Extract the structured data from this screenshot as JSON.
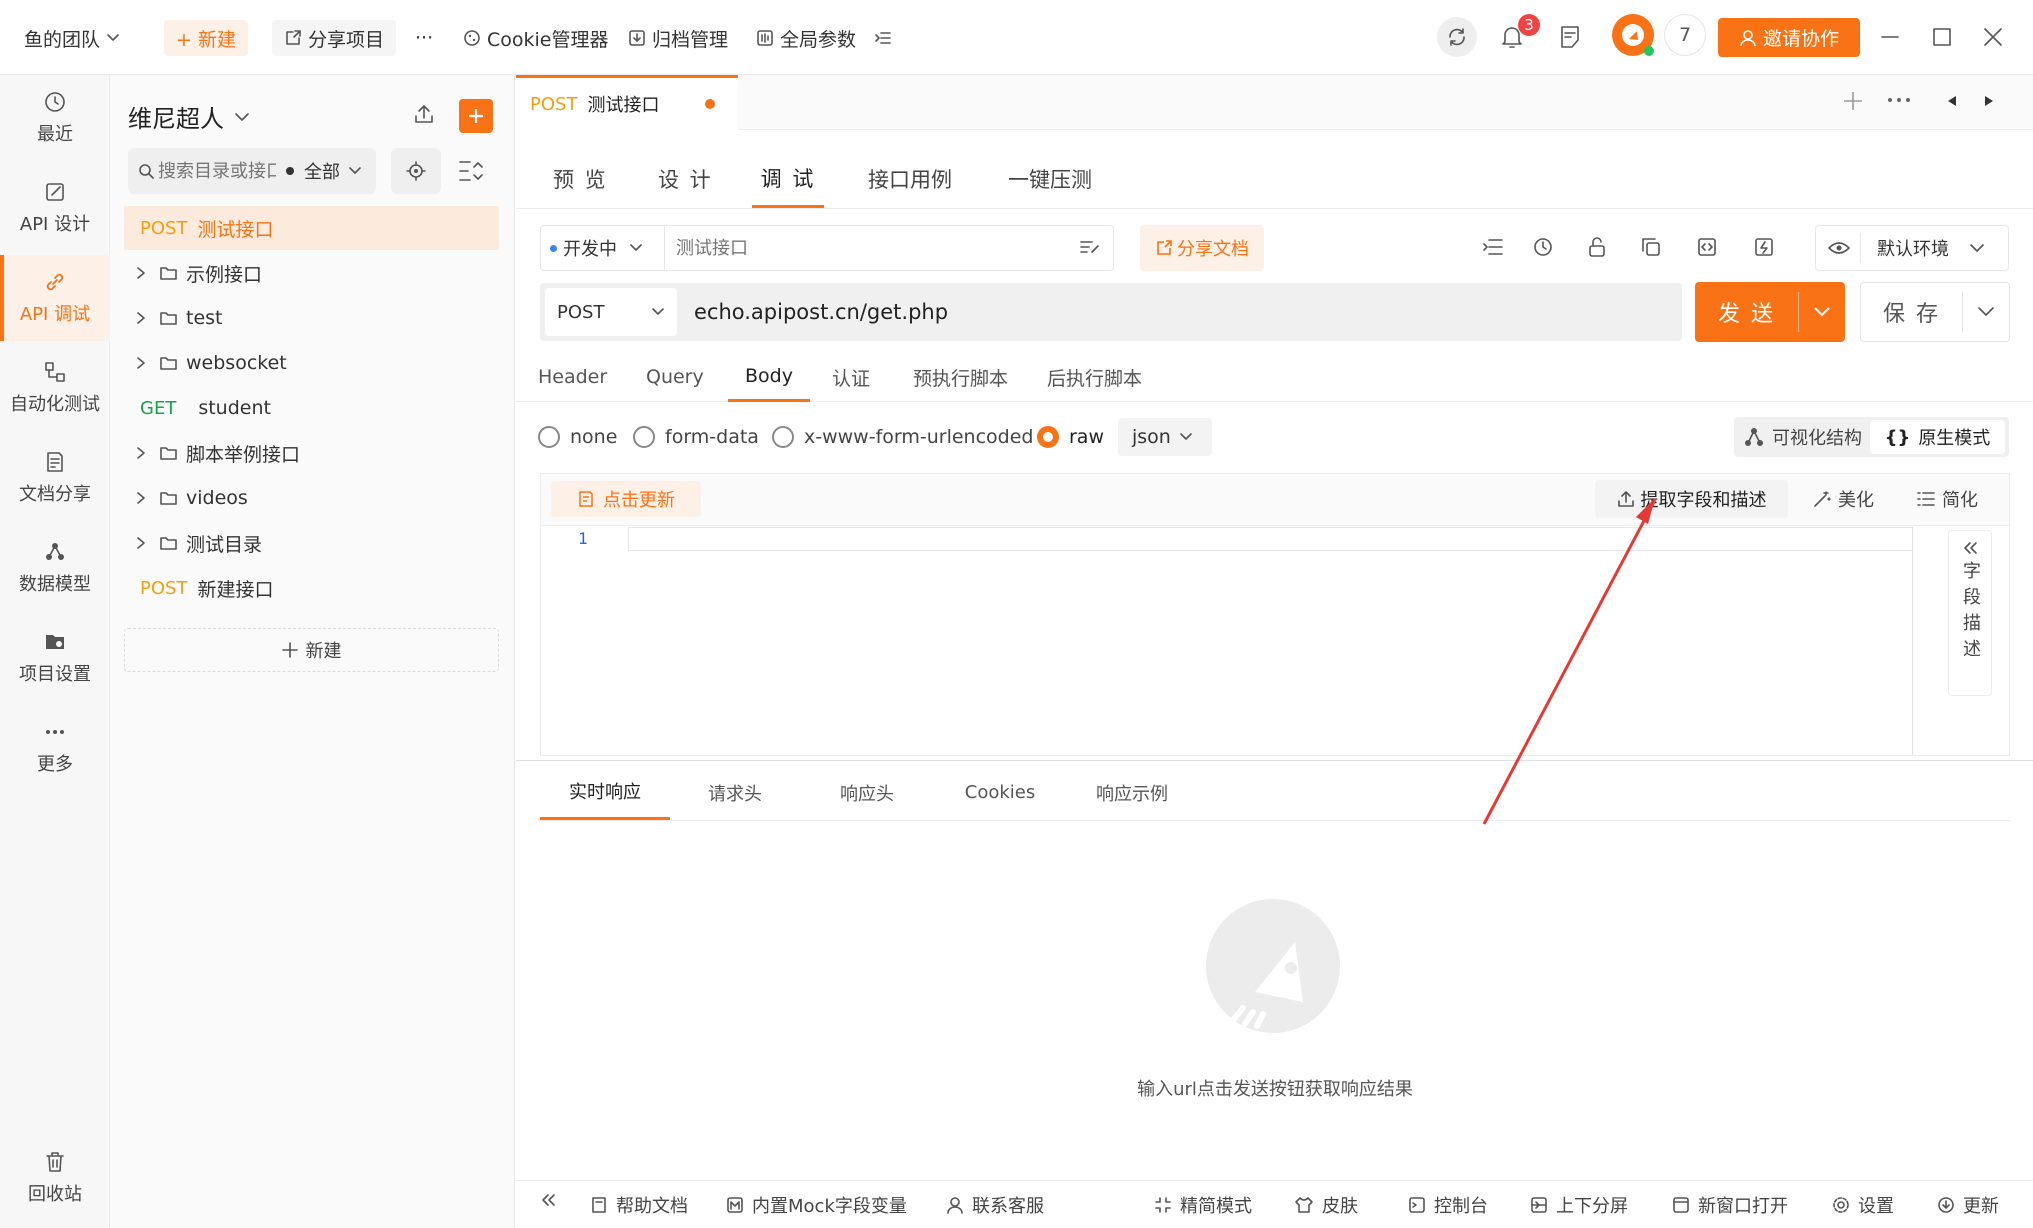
{
  "topbar": {
    "team": "鱼的团队",
    "new_btn": "+ 新建",
    "share_project": "分享项目",
    "more": "···",
    "cookie_mgr": "Cookie管理器",
    "archive": "归档管理",
    "global_params": "全局参数",
    "notification_count": "3",
    "user_count": "7",
    "invite": "邀请协作"
  },
  "rail": [
    {
      "label": "最近",
      "icon": "clock-icon"
    },
    {
      "label": "API 设计",
      "icon": "edit-icon"
    },
    {
      "label": "API 调试",
      "icon": "link-icon"
    },
    {
      "label": "自动化测试",
      "icon": "flow-icon"
    },
    {
      "label": "文档分享",
      "icon": "doc-icon"
    },
    {
      "label": "数据模型",
      "icon": "model-icon"
    },
    {
      "label": "项目设置",
      "icon": "folder-gear-icon"
    },
    {
      "label": "更多",
      "icon": "more-icon"
    },
    {
      "label": "回收站",
      "icon": "trash-icon"
    }
  ],
  "sidebar": {
    "project": "维尼超人",
    "search_placeholder": "搜索目录或接口",
    "filter": "全部",
    "new_label": "新建",
    "items": [
      {
        "method": "POST",
        "label": "测试接口"
      },
      {
        "label": "示例接口"
      },
      {
        "label": "test"
      },
      {
        "label": "websocket"
      },
      {
        "method": "GET",
        "label": "student"
      },
      {
        "label": "脚本举例接口"
      },
      {
        "label": "videos"
      },
      {
        "label": "测试目录"
      },
      {
        "method": "POST",
        "label": "新建接口"
      }
    ]
  },
  "tab": {
    "method": "POST",
    "label": "测试接口"
  },
  "subnav": [
    "预 览",
    "设 计",
    "调 试",
    "接口用例",
    "一键压测"
  ],
  "toolbar": {
    "status": "开发中",
    "name_placeholder": "测试接口",
    "share_doc": "分享文档",
    "env": "默认环境"
  },
  "request": {
    "method": "POST",
    "url": "echo.apipost.cn/get.php",
    "send": "发 送",
    "save": "保 存"
  },
  "req_tabs": [
    "Header",
    "Query",
    "Body",
    "认证",
    "预执行脚本",
    "后执行脚本"
  ],
  "body": {
    "types": [
      "none",
      "form-data",
      "x-www-form-urlencoded",
      "raw"
    ],
    "selected": "raw",
    "format": "json",
    "mode_visual": "可视化结构",
    "mode_raw": "原生模式",
    "update": "点击更新",
    "extract": "提取字段和描述",
    "beautify": "美化",
    "simplify": "简化",
    "line1": "1",
    "field_desc": "字段描述"
  },
  "response": {
    "tabs": [
      "实时响应",
      "请求头",
      "响应头",
      "Cookies",
      "响应示例"
    ],
    "empty": "输入url点击发送按钮获取响应结果"
  },
  "status_bar": [
    "帮助文档",
    "内置Mock字段变量",
    "联系客服",
    "精简模式",
    "皮肤",
    "控制台",
    "上下分屏",
    "新窗口打开",
    "设置",
    "更新"
  ],
  "colors": {
    "accent": "#f97316",
    "arrow": "#e53935"
  }
}
